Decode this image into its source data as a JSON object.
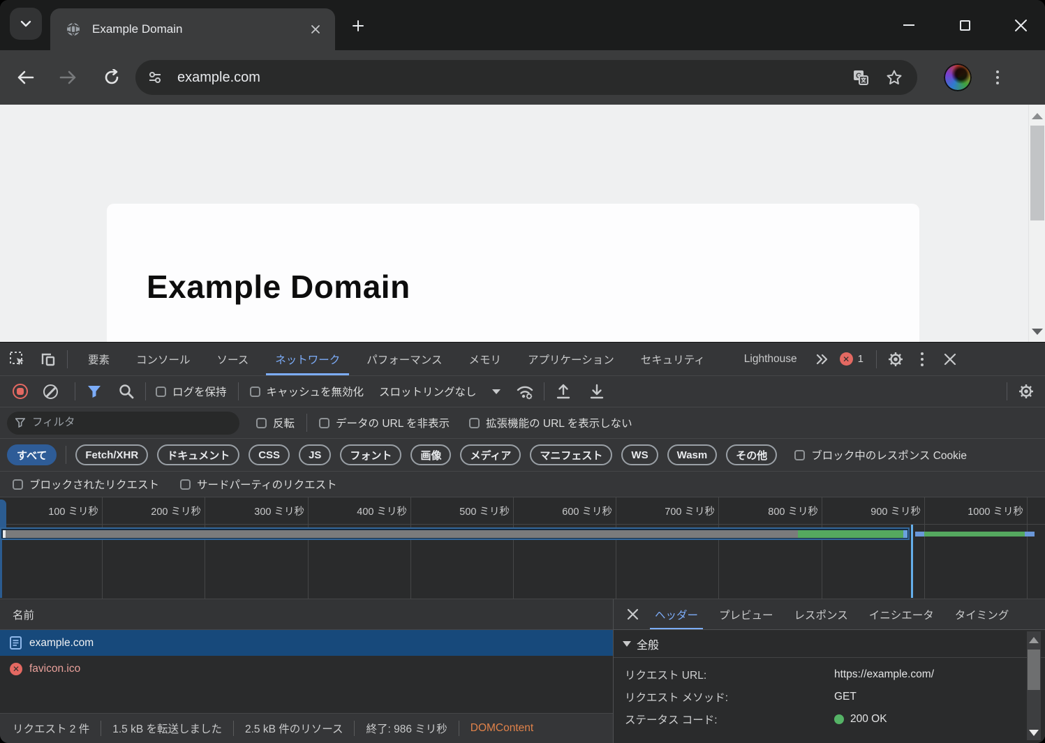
{
  "browser": {
    "tab_title": "Example Domain",
    "url": "example.com"
  },
  "page": {
    "heading": "Example Domain"
  },
  "devtools": {
    "tabs": {
      "elements": "要素",
      "console": "コンソール",
      "sources": "ソース",
      "network": "ネットワーク",
      "performance": "パフォーマンス",
      "memory": "メモリ",
      "application": "アプリケーション",
      "security": "セキュリティ",
      "lighthouse": "Lighthouse"
    },
    "error_count": "1",
    "net_toolbar": {
      "preserve_log": "ログを保持",
      "disable_cache": "キャッシュを無効化",
      "throttling": "スロットリングなし"
    },
    "filter_row": {
      "placeholder": "フィルタ",
      "invert": "反転",
      "hide_data_urls": "データの URL を非表示",
      "hide_extension_urls": "拡張機能の URL を表示しない"
    },
    "chips": {
      "all": "すべて",
      "fetch_xhr": "Fetch/XHR",
      "document": "ドキュメント",
      "css": "CSS",
      "js": "JS",
      "font": "フォント",
      "image": "画像",
      "media": "メディア",
      "manifest": "マニフェスト",
      "ws": "WS",
      "wasm": "Wasm",
      "other": "その他"
    },
    "blocked_cookies": "ブロック中のレスポンス Cookie",
    "blocked_requests": "ブロックされたリクエスト",
    "third_party_requests": "サードパーティのリクエスト",
    "timeline_ticks": [
      "100 ミリ秒",
      "200 ミリ秒",
      "300 ミリ秒",
      "400 ミリ秒",
      "500 ミリ秒",
      "600 ミリ秒",
      "700 ミリ秒",
      "800 ミリ秒",
      "900 ミリ秒",
      "1000 ミリ秒"
    ],
    "table": {
      "name_header": "名前",
      "rows": [
        {
          "name": "example.com"
        },
        {
          "name": "favicon.ico"
        }
      ]
    },
    "details": {
      "tabs": {
        "headers": "ヘッダー",
        "preview": "プレビュー",
        "response": "レスポンス",
        "initiator": "イニシエータ",
        "timing": "タイミング"
      },
      "general_title": "全般",
      "fields": [
        {
          "label": "リクエスト URL:",
          "value": "https://example.com/"
        },
        {
          "label": "リクエスト メソッド:",
          "value": "GET"
        },
        {
          "label": "ステータス コード:",
          "value": "200 OK"
        }
      ]
    },
    "statusbar": {
      "requests": "リクエスト 2 件",
      "transferred": "1.5 kB を転送しました",
      "resources": "2.5 kB 件のリソース",
      "finish": "終了: 986 ミリ秒",
      "domcontent": "DOMContent"
    }
  },
  "colors": {
    "accent_blue": "#7cacf8",
    "row_selection_blue": "#17497b",
    "chip_active_blue": "#2e5c97",
    "error_red": "#e46962",
    "success_green": "#55b366",
    "waterfall_gray": "#7a7b7c",
    "waterfall_green": "#55a85f",
    "dcl_marker_blue": "#64aeea",
    "domcontent_orange": "#e0824a"
  }
}
